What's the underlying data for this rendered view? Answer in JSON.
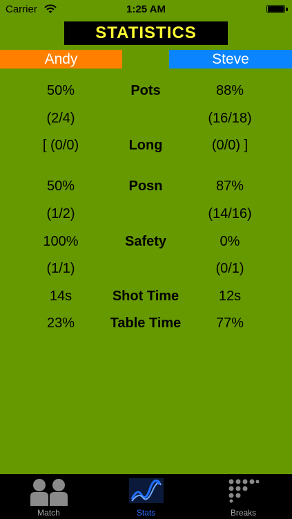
{
  "status_bar": {
    "carrier": "Carrier",
    "time": "1:25 AM"
  },
  "header": {
    "title": "STATISTICS"
  },
  "players": {
    "left": {
      "name": "Andy",
      "color": "#ff8000"
    },
    "right": {
      "name": "Steve",
      "color": "#0a84ff"
    }
  },
  "stats": [
    {
      "left": "50%",
      "label": "Pots",
      "right": "88%"
    },
    {
      "left": "(2/4)",
      "label": "",
      "right": "(16/18)"
    },
    {
      "left": "[ (0/0)",
      "label": "Long",
      "right": "(0/0) ]"
    },
    {
      "left": "50%",
      "label": "Posn",
      "right": "87%"
    },
    {
      "left": "(1/2)",
      "label": "",
      "right": "(14/16)"
    },
    {
      "left": "100%",
      "label": "Safety",
      "right": "0%"
    },
    {
      "left": "(1/1)",
      "label": "",
      "right": "(0/1)"
    },
    {
      "left": "14s",
      "label": "Shot Time",
      "right": "12s"
    },
    {
      "left": "23%",
      "label": "Table Time",
      "right": "77%"
    }
  ],
  "tabs": [
    {
      "label": "Match",
      "icon": "players-icon",
      "active": false
    },
    {
      "label": "Stats",
      "icon": "chart-icon",
      "active": true
    },
    {
      "label": "Breaks",
      "icon": "grid-icon",
      "active": false
    }
  ],
  "colors": {
    "background": "#669900",
    "title_text": "#ffff33",
    "tab_active": "#2b6cff",
    "tab_inactive": "#a8a8a8"
  }
}
